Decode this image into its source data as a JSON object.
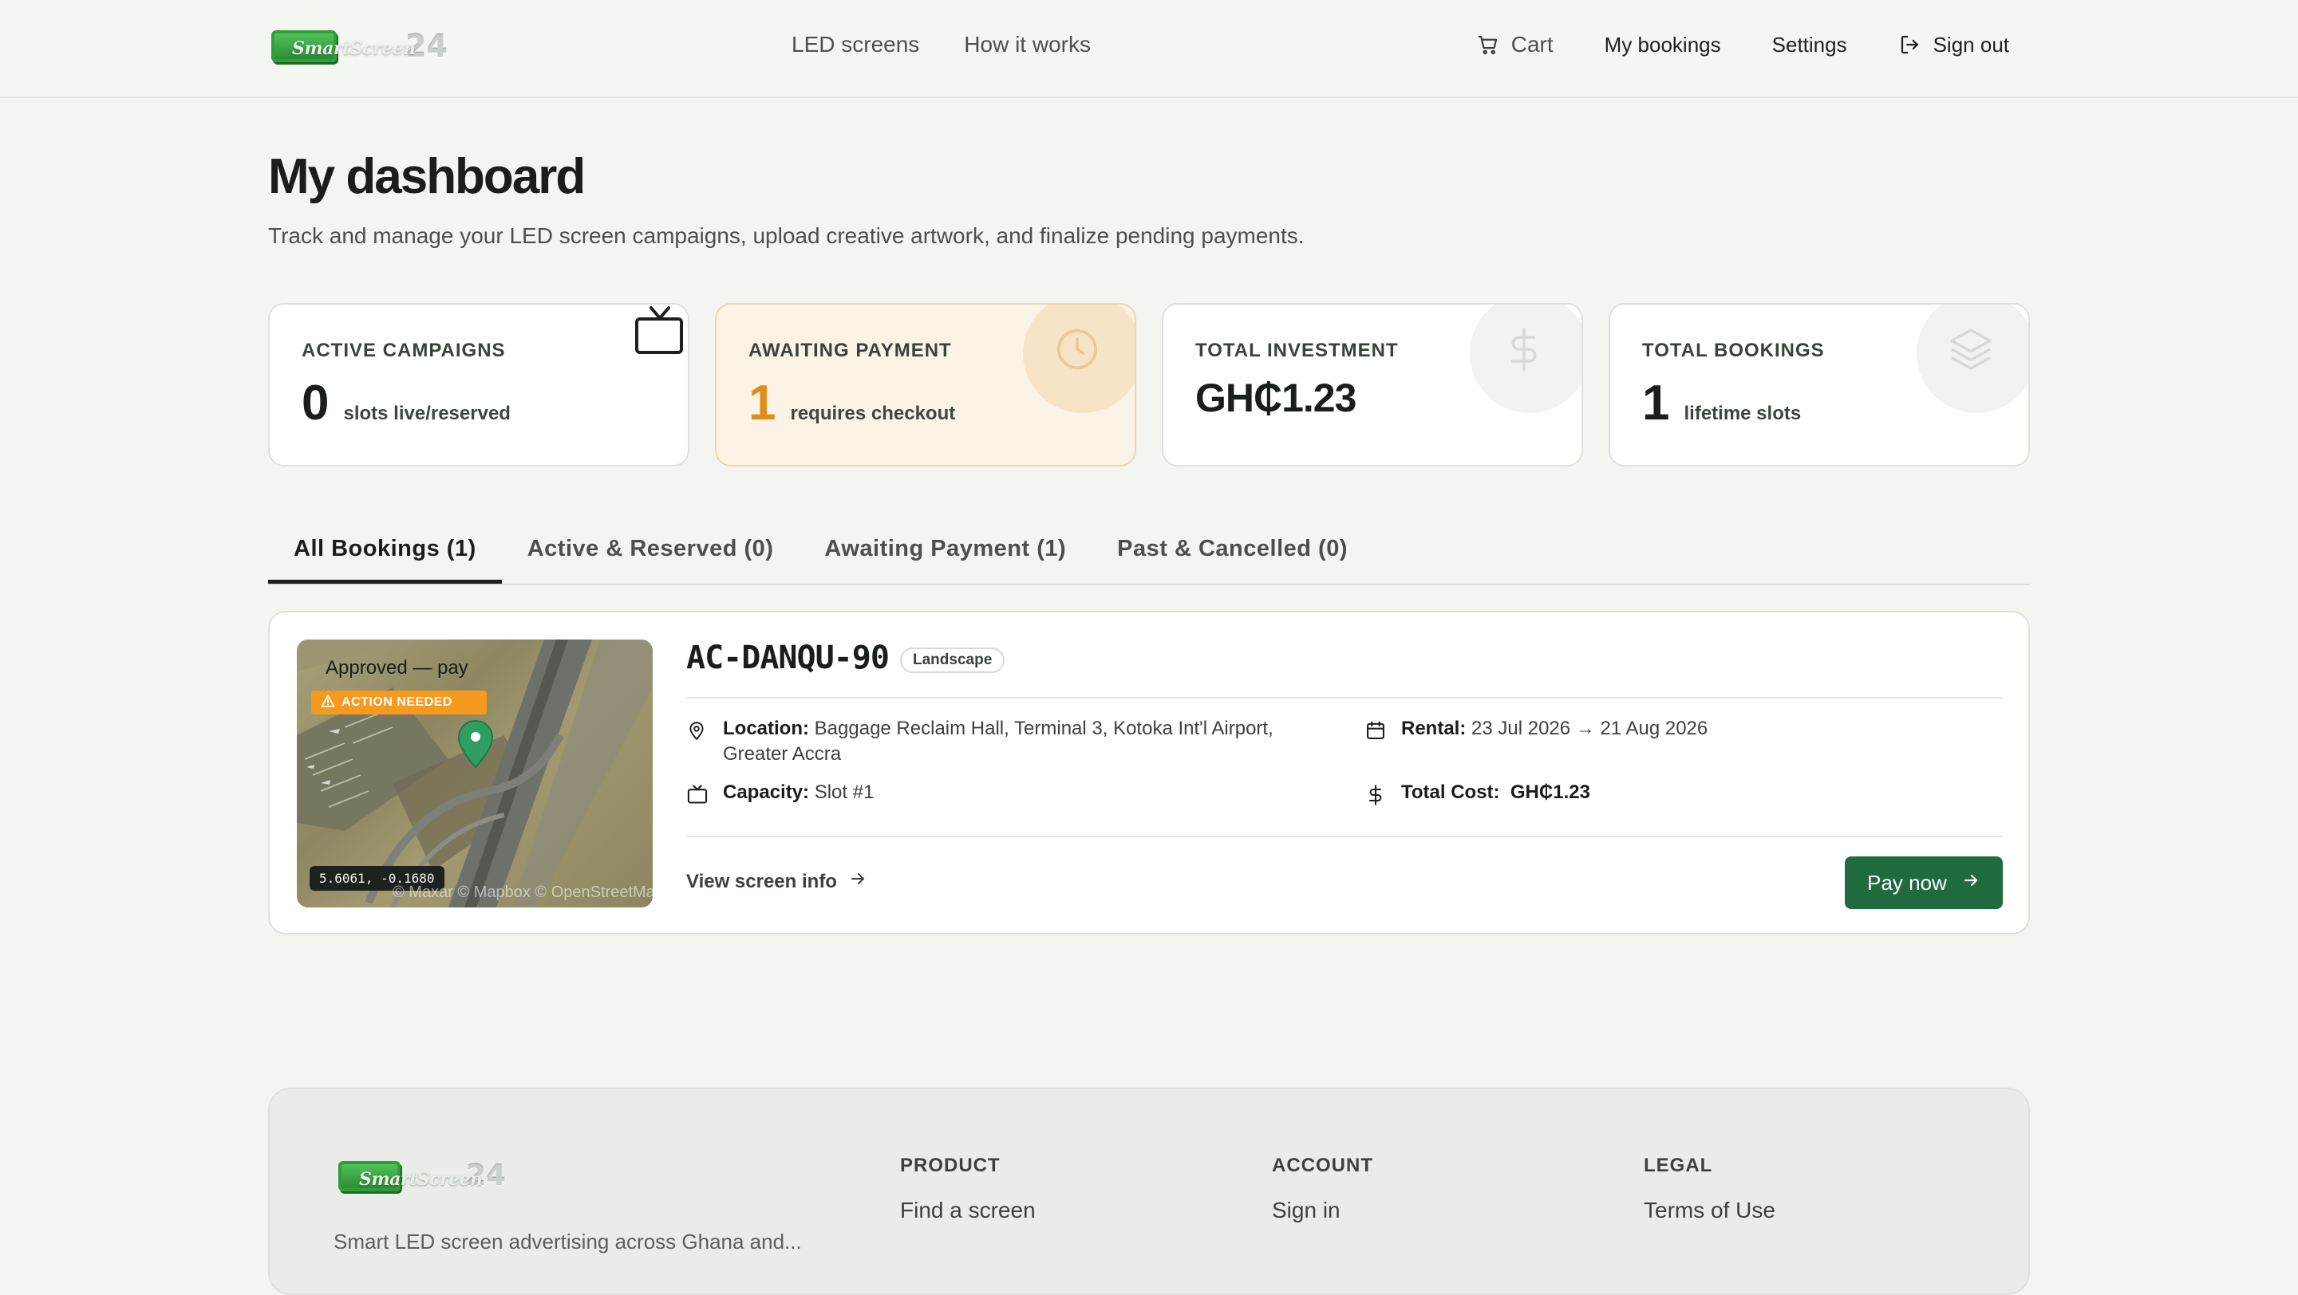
{
  "nav": {
    "logo_word": "SmartScreen",
    "logo_number": "24",
    "center_links": [
      "LED screens",
      "How it works"
    ],
    "cart_label": "Cart",
    "bookings_label": "My bookings",
    "settings_label": "Settings",
    "signout_label": "Sign out"
  },
  "header": {
    "title": "My dashboard",
    "subtitle": "Track and manage your LED screen campaigns, upload creative artwork, and finalize pending payments."
  },
  "stats": [
    {
      "label": "ACTIVE CAMPAIGNS",
      "value": "0",
      "unit": "slots live/reserved",
      "icon": "tv-icon"
    },
    {
      "label": "AWAITING PAYMENT",
      "value": "1",
      "unit": "requires checkout",
      "icon": "clock-icon"
    },
    {
      "label": "TOTAL INVESTMENT",
      "value": "GH₵1.23",
      "unit": "",
      "icon": "dollar-icon"
    },
    {
      "label": "TOTAL BOOKINGS",
      "value": "1",
      "unit": "lifetime slots",
      "icon": "layers-icon"
    }
  ],
  "tabs": [
    {
      "label": "All Bookings (1)",
      "active": true
    },
    {
      "label": "Active & Reserved (0)",
      "active": false
    },
    {
      "label": "Awaiting Payment (1)",
      "active": false
    },
    {
      "label": "Past & Cancelled (0)",
      "active": false
    }
  ],
  "booking": {
    "status_text": "Approved — pay",
    "action_badge": "ACTION NEEDED",
    "coords": "5.6061, -0.1680",
    "attribution": "© Maxar © Mapbox © OpenStreetMap",
    "code": "AC-DANQU-90",
    "orientation": "Landscape",
    "location_label": "Location:",
    "location_value": "Baggage Reclaim Hall, Terminal 3, Kotoka Int'l Airport, Greater Accra",
    "rental_label": "Rental:",
    "rental_value": "23 Jul 2026 → 21 Aug 2026",
    "capacity_label": "Capacity:",
    "capacity_value": "Slot #1",
    "total_label": "Total Cost:",
    "total_value": "GH₵1.23",
    "view_link": "View screen info",
    "pay_button": "Pay now"
  },
  "footer": {
    "logo_word": "SmartScreen",
    "logo_number": "24",
    "tagline": "Smart LED screen advertising across Ghana and...",
    "columns": [
      {
        "heading": "PRODUCT",
        "first_link": "Find a screen"
      },
      {
        "heading": "ACCOUNT",
        "first_link": "Sign in"
      },
      {
        "heading": "LEGAL",
        "first_link": "Terms of Use"
      }
    ]
  },
  "colors": {
    "brand_green": "#1f6b3f",
    "warning_orange": "#f59a1f",
    "awaiting_value": "#e08e1b",
    "page_background": "#f3f5f1"
  }
}
